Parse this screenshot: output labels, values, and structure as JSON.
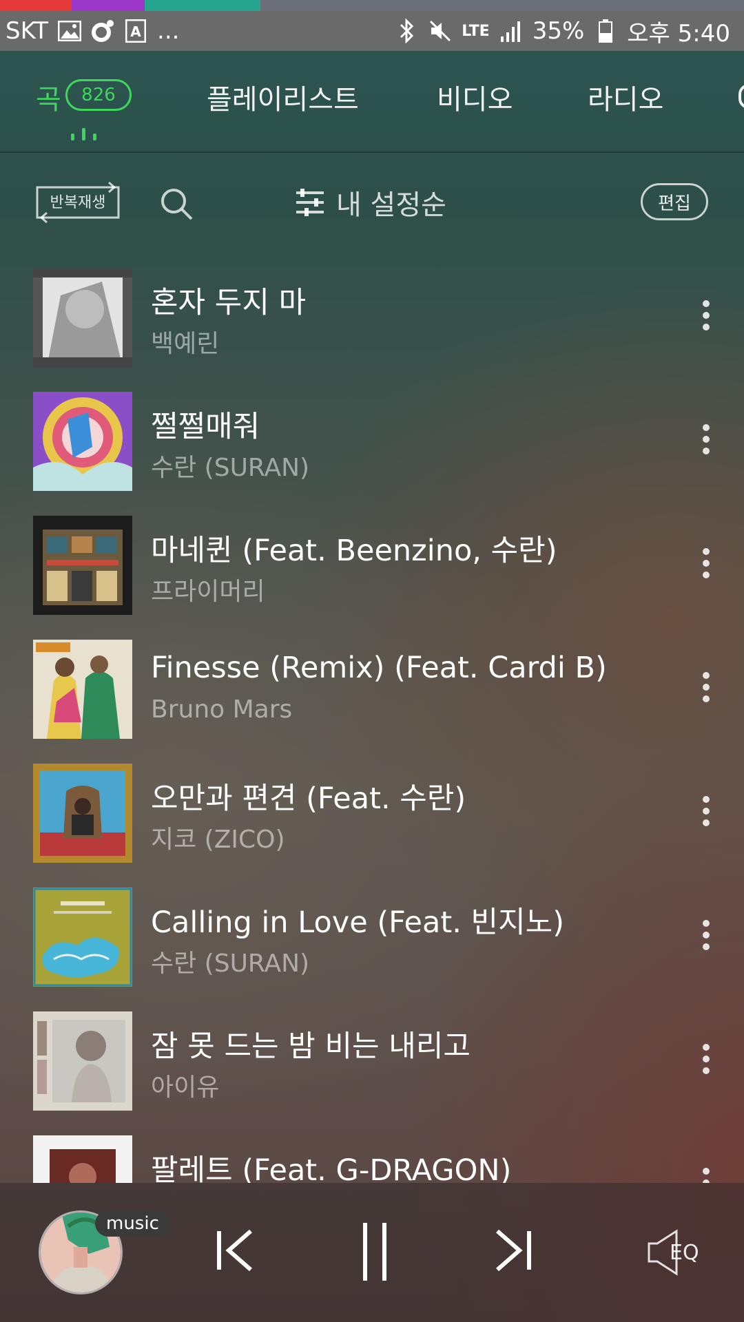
{
  "status_bar": {
    "carrier": "SKT",
    "more": "...",
    "network": "LTE",
    "battery": "35%",
    "time": "오후 5:40",
    "strip_colors": [
      "#e53a3a",
      "#9b36c9",
      "#6b6b6b",
      "#26a58f",
      "#7a7a7a"
    ]
  },
  "tabs": [
    {
      "label": "곡",
      "count": "826",
      "active": true
    },
    {
      "label": "플레이리스트",
      "active": false
    },
    {
      "label": "비디오",
      "active": false
    },
    {
      "label": "라디오",
      "active": false
    }
  ],
  "toolbar": {
    "repeat_label": "반복재생",
    "sort_label": "내 설정순",
    "edit_label": "편집"
  },
  "songs": [
    {
      "title": "혼자 두지 마",
      "artist": "백예린"
    },
    {
      "title": "쩔쩔매줘",
      "artist": "수란 (SURAN)"
    },
    {
      "title": "마네퀸 (Feat. Beenzino, 수란)",
      "artist": "프라이머리"
    },
    {
      "title": "Finesse (Remix) (Feat. Cardi B)",
      "artist": "Bruno Mars"
    },
    {
      "title": "오만과 편견 (Feat. 수란)",
      "artist": "지코 (ZICO)"
    },
    {
      "title": "Calling in Love (Feat. 빈지노)",
      "artist": "수란 (SURAN)"
    },
    {
      "title": "잠 못 드는 밤 비는 내리고",
      "artist": "아이유"
    },
    {
      "title": "팔레트 (Feat. G-DRAGON)",
      "artist": ""
    }
  ],
  "player": {
    "badge": "music",
    "eq_label": "EQ"
  },
  "colors": {
    "accent": "#3fd65d"
  }
}
